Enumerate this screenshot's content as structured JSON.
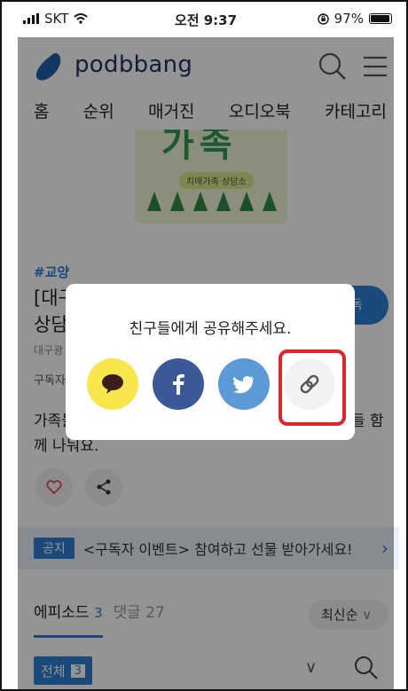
{
  "status_bar": {
    "carrier": "SKT",
    "time": "오전 9:37",
    "battery": "97%",
    "battery_level": 0.97
  },
  "header": {
    "logo_text": "podbbang"
  },
  "nav": {
    "items": [
      "홈",
      "순위",
      "매거진",
      "오디오북",
      "카테고리"
    ]
  },
  "cover": {
    "title_fragment": "가족",
    "subtitle": "치매가족 상담소"
  },
  "channel": {
    "tag": "#교양",
    "title_fragment_1": "[대구",
    "title_fragment_2": "상담",
    "author_fragment": "대구광",
    "subscribers_fragment": "구독자",
    "subscribe_fragment": "독",
    "description_fragment_1": "가족들",
    "description_fragment_1b": "들 함",
    "description_fragment_2": "께 나눠요."
  },
  "notice": {
    "badge": "공지",
    "text": "<구독자 이벤트> 참여하고 선물 받아가세요!"
  },
  "tabs": {
    "episodes_label": "에피소드",
    "episodes_count": "3",
    "comments_label": "댓글 27",
    "sort_label": "최신순"
  },
  "filter": {
    "all_label": "전체",
    "all_count": "3"
  },
  "share_modal": {
    "title": "친구들에게 공유해주세요.",
    "options": [
      "kakaotalk-icon",
      "facebook-icon",
      "twitter-icon",
      "link-icon"
    ]
  },
  "colors": {
    "brand_blue": "#2f7fd3",
    "kakao_yellow": "#f9e54c",
    "facebook_blue": "#3b5998",
    "twitter_blue": "#5b9ad5",
    "highlight_red": "#e0242b"
  }
}
